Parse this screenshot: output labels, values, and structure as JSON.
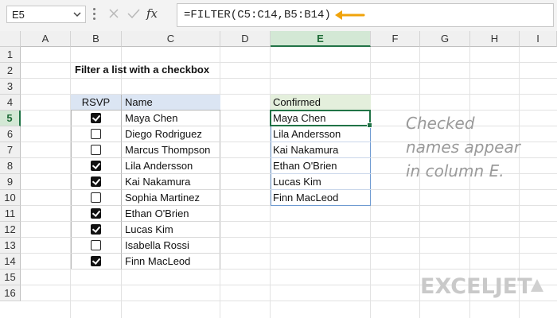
{
  "formula_bar": {
    "name_box": "E5",
    "fx_label": "fx",
    "formula": "=FILTER(C5:C14,B5:B14)",
    "arrow_color": "#f0a30a"
  },
  "columns": [
    "A",
    "B",
    "C",
    "D",
    "E",
    "F",
    "G",
    "H",
    "I"
  ],
  "active_column": "E",
  "rows": [
    "1",
    "2",
    "3",
    "4",
    "5",
    "6",
    "7",
    "8",
    "9",
    "10",
    "11",
    "12",
    "13",
    "14",
    "15",
    "16"
  ],
  "active_row": "5",
  "sheet": {
    "title": "Filter a list with a checkbox",
    "table_headers": {
      "rsvp": "RSVP",
      "name": "Name"
    },
    "entries": [
      {
        "checked": true,
        "name": "Maya Chen"
      },
      {
        "checked": false,
        "name": "Diego Rodriguez"
      },
      {
        "checked": false,
        "name": "Marcus Thompson"
      },
      {
        "checked": true,
        "name": "Lila Andersson"
      },
      {
        "checked": true,
        "name": "Kai Nakamura"
      },
      {
        "checked": false,
        "name": "Sophia Martinez"
      },
      {
        "checked": true,
        "name": "Ethan O'Brien"
      },
      {
        "checked": true,
        "name": "Lucas Kim"
      },
      {
        "checked": false,
        "name": "Isabella Rossi"
      },
      {
        "checked": true,
        "name": "Finn MacLeod"
      }
    ],
    "confirmed_header": "Confirmed",
    "confirmed": [
      "Maya Chen",
      "Lila Andersson",
      "Kai Nakamura",
      "Ethan O'Brien",
      "Lucas Kim",
      "Finn MacLeod"
    ],
    "note_lines": [
      "Checked",
      "names appear",
      "in column E."
    ]
  },
  "logo": {
    "text": "EXCELJET"
  },
  "colors": {
    "selection": "#217346",
    "header_blue": "#dbe5f3",
    "header_green": "#e4efdc",
    "table_border": "#8ea9db",
    "confirmed_border": "#6f9bd1"
  }
}
